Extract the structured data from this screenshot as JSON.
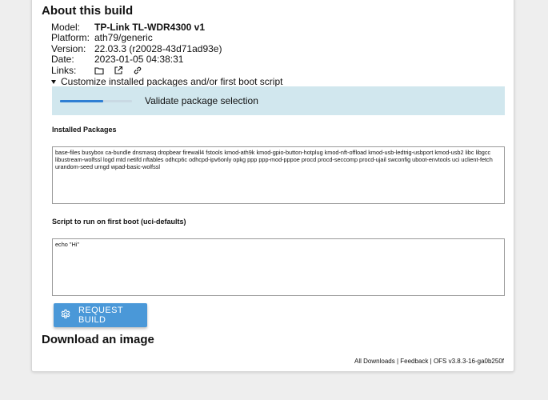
{
  "about": {
    "title": "About this build",
    "rows": [
      {
        "key": "Model:",
        "value": "TP-Link TL-WDR4300 v1"
      },
      {
        "key": "Platform:",
        "value": "ath79/generic"
      },
      {
        "key": "Version:",
        "value": "22.03.3 (r20028-43d71ad93e)"
      },
      {
        "key": "Date:",
        "value": "2023-01-05 04:38:31"
      }
    ],
    "links_label": "Links:",
    "link_icons": [
      "folder-icon",
      "external-link-icon",
      "link-icon"
    ]
  },
  "customize": {
    "label": "Customize installed packages and/or first boot script",
    "validate_text": "Validate package selection",
    "progress_fraction": 0.6
  },
  "packages": {
    "label": "Installed Packages",
    "value": "base-files busybox ca-bundle dnsmasq dropbear firewall4 fstools kmod-ath9k kmod-gpio-button-hotplug kmod-nft-offload kmod-usb-ledtrig-usbport kmod-usb2 libc libgcc libustream-wolfssl logd mtd netifd nftables odhcp6c odhcpd-ipv6only opkg ppp ppp-mod-pppoe procd procd-seccomp procd-ujail swconfig uboot-envtools uci uclient-fetch urandom-seed urngd wpad-basic-wolfssl"
  },
  "script": {
    "label": "Script to run on first boot (uci-defaults)",
    "value": "echo \"Hi\""
  },
  "request_build": {
    "label": "REQUEST BUILD",
    "icon": "gear-icon"
  },
  "download": {
    "title": "Download an image"
  },
  "footer": {
    "all_downloads": "All Downloads",
    "sep1": " | ",
    "feedback": "Feedback",
    "sep2": " | ",
    "version": "OFS v3.8.3-16-ga0b250f"
  },
  "colors": {
    "accent": "#4a98d8",
    "validate_bg": "#d1e7ee",
    "progress": "#2f7fd3"
  }
}
